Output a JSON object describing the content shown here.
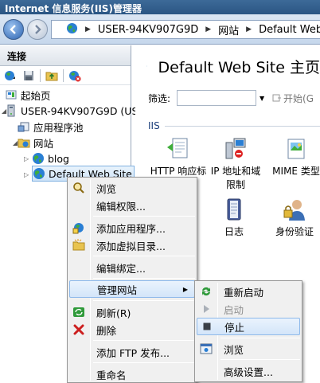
{
  "window": {
    "title": "Internet 信息服务(IIS)管理器"
  },
  "address": {
    "crumbs": [
      "USER-94KV907G9D",
      "网站",
      "Default Web Site"
    ],
    "separator": "▶"
  },
  "connections": {
    "header": "连接",
    "tree": {
      "start_page": "起始页",
      "server": "USER-94KV907G9D (US",
      "app_pools": "应用程序池",
      "sites": "网站",
      "site_blog": "blog",
      "site_default": "Default Web Site"
    }
  },
  "main": {
    "title": "Default Web Site 主页",
    "filter_label": "筛选:",
    "go_label": "开始(G",
    "group": "IIS",
    "features": [
      {
        "label1": "HTTP 响应标",
        "label2": ""
      },
      {
        "label1": "IP 地址和域",
        "label2": "限制"
      },
      {
        "label1": "MIME 类型",
        "label2": ""
      },
      {
        "label1": "日志",
        "label2": ""
      },
      {
        "label1": "身份验证",
        "label2": ""
      }
    ]
  },
  "context_menu": {
    "items": [
      "浏览",
      "编辑权限...",
      "添加应用程序...",
      "添加虚拟目录...",
      "编辑绑定...",
      "管理网站",
      "刷新(R)",
      "删除",
      "添加 FTP 发布...",
      "重命名"
    ]
  },
  "submenu": {
    "items": [
      "重新启动",
      "启动",
      "停止",
      "浏览",
      "高级设置..."
    ]
  },
  "colors": {
    "titlebar": "#2f5b8a",
    "highlight_border": "#8eb9ea",
    "delete_red": "#cc1f1f",
    "refresh_green": "#2f9a3a"
  }
}
